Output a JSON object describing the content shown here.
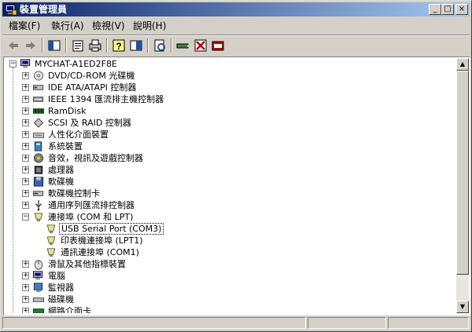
{
  "window": {
    "title": "裝置管理員",
    "controls": {
      "minimize": "_",
      "maximize": "□",
      "close": "×"
    }
  },
  "menu": [
    "檔案(F)",
    "執行(A)",
    "檢視(V)",
    "說明(H)"
  ],
  "toolbar": [
    "back-arrow-icon",
    "forward-arrow-icon",
    "show-hide-tree-icon",
    "properties-icon",
    "print-icon",
    "help-icon",
    "help-topics-icon",
    "scan-hardware-icon",
    "update-driver-icon",
    "disable-device-icon",
    "uninstall-device-icon"
  ],
  "tree": {
    "root": "MYCHAT-A1ED2F8E",
    "items": [
      {
        "label": "DVD/CD-ROM 光碟機",
        "icon": "cdrom-icon",
        "expander": "+"
      },
      {
        "label": "IDE ATA/ATAPI 控制器",
        "icon": "ide-controller-icon",
        "expander": "+"
      },
      {
        "label": "IEEE 1394 匯流排主機控制器",
        "icon": "firewire-icon",
        "expander": "+"
      },
      {
        "label": "RamDisk",
        "icon": "ramdisk-icon",
        "expander": "+"
      },
      {
        "label": "SCSI 及 RAID 控制器",
        "icon": "scsi-icon",
        "expander": "+"
      },
      {
        "label": "人性化介面裝置",
        "icon": "hid-icon",
        "expander": "+"
      },
      {
        "label": "系統裝置",
        "icon": "system-device-icon",
        "expander": "+"
      },
      {
        "label": "音效，視訊及遊戲控制器",
        "icon": "sound-icon",
        "expander": "+"
      },
      {
        "label": "處理器",
        "icon": "processor-icon",
        "expander": "+"
      },
      {
        "label": "軟碟機",
        "icon": "floppy-drive-icon",
        "expander": "+"
      },
      {
        "label": "軟碟機控制卡",
        "icon": "floppy-controller-icon",
        "expander": "+"
      },
      {
        "label": "通用序列匯流排控制器",
        "icon": "usb-icon",
        "expander": "+"
      },
      {
        "label": "連接埠 (COM 和 LPT)",
        "icon": "port-icon",
        "expander": "−",
        "children": [
          {
            "label": "USB Serial Port (COM3)",
            "icon": "port-icon",
            "selected": true
          },
          {
            "label": "印表機連接埠 (LPT1)",
            "icon": "port-icon"
          },
          {
            "label": "通訊連接埠 (COM1)",
            "icon": "port-icon"
          }
        ]
      },
      {
        "label": "滑鼠及其他指標裝置",
        "icon": "mouse-icon",
        "expander": "+"
      },
      {
        "label": "電腦",
        "icon": "computer-icon",
        "expander": "+"
      },
      {
        "label": "監視器",
        "icon": "monitor-icon",
        "expander": "+"
      },
      {
        "label": "磁碟機",
        "icon": "disk-drive-icon",
        "expander": "+"
      },
      {
        "label": "網路介面卡",
        "icon": "network-adapter-icon",
        "expander": "+"
      }
    ]
  },
  "scrollbar": {
    "up": "▲",
    "down": "▼"
  },
  "colors": {
    "titlebar_start": "#0a246a",
    "titlebar_end": "#a6caf0",
    "face": "#d4d0c8"
  }
}
